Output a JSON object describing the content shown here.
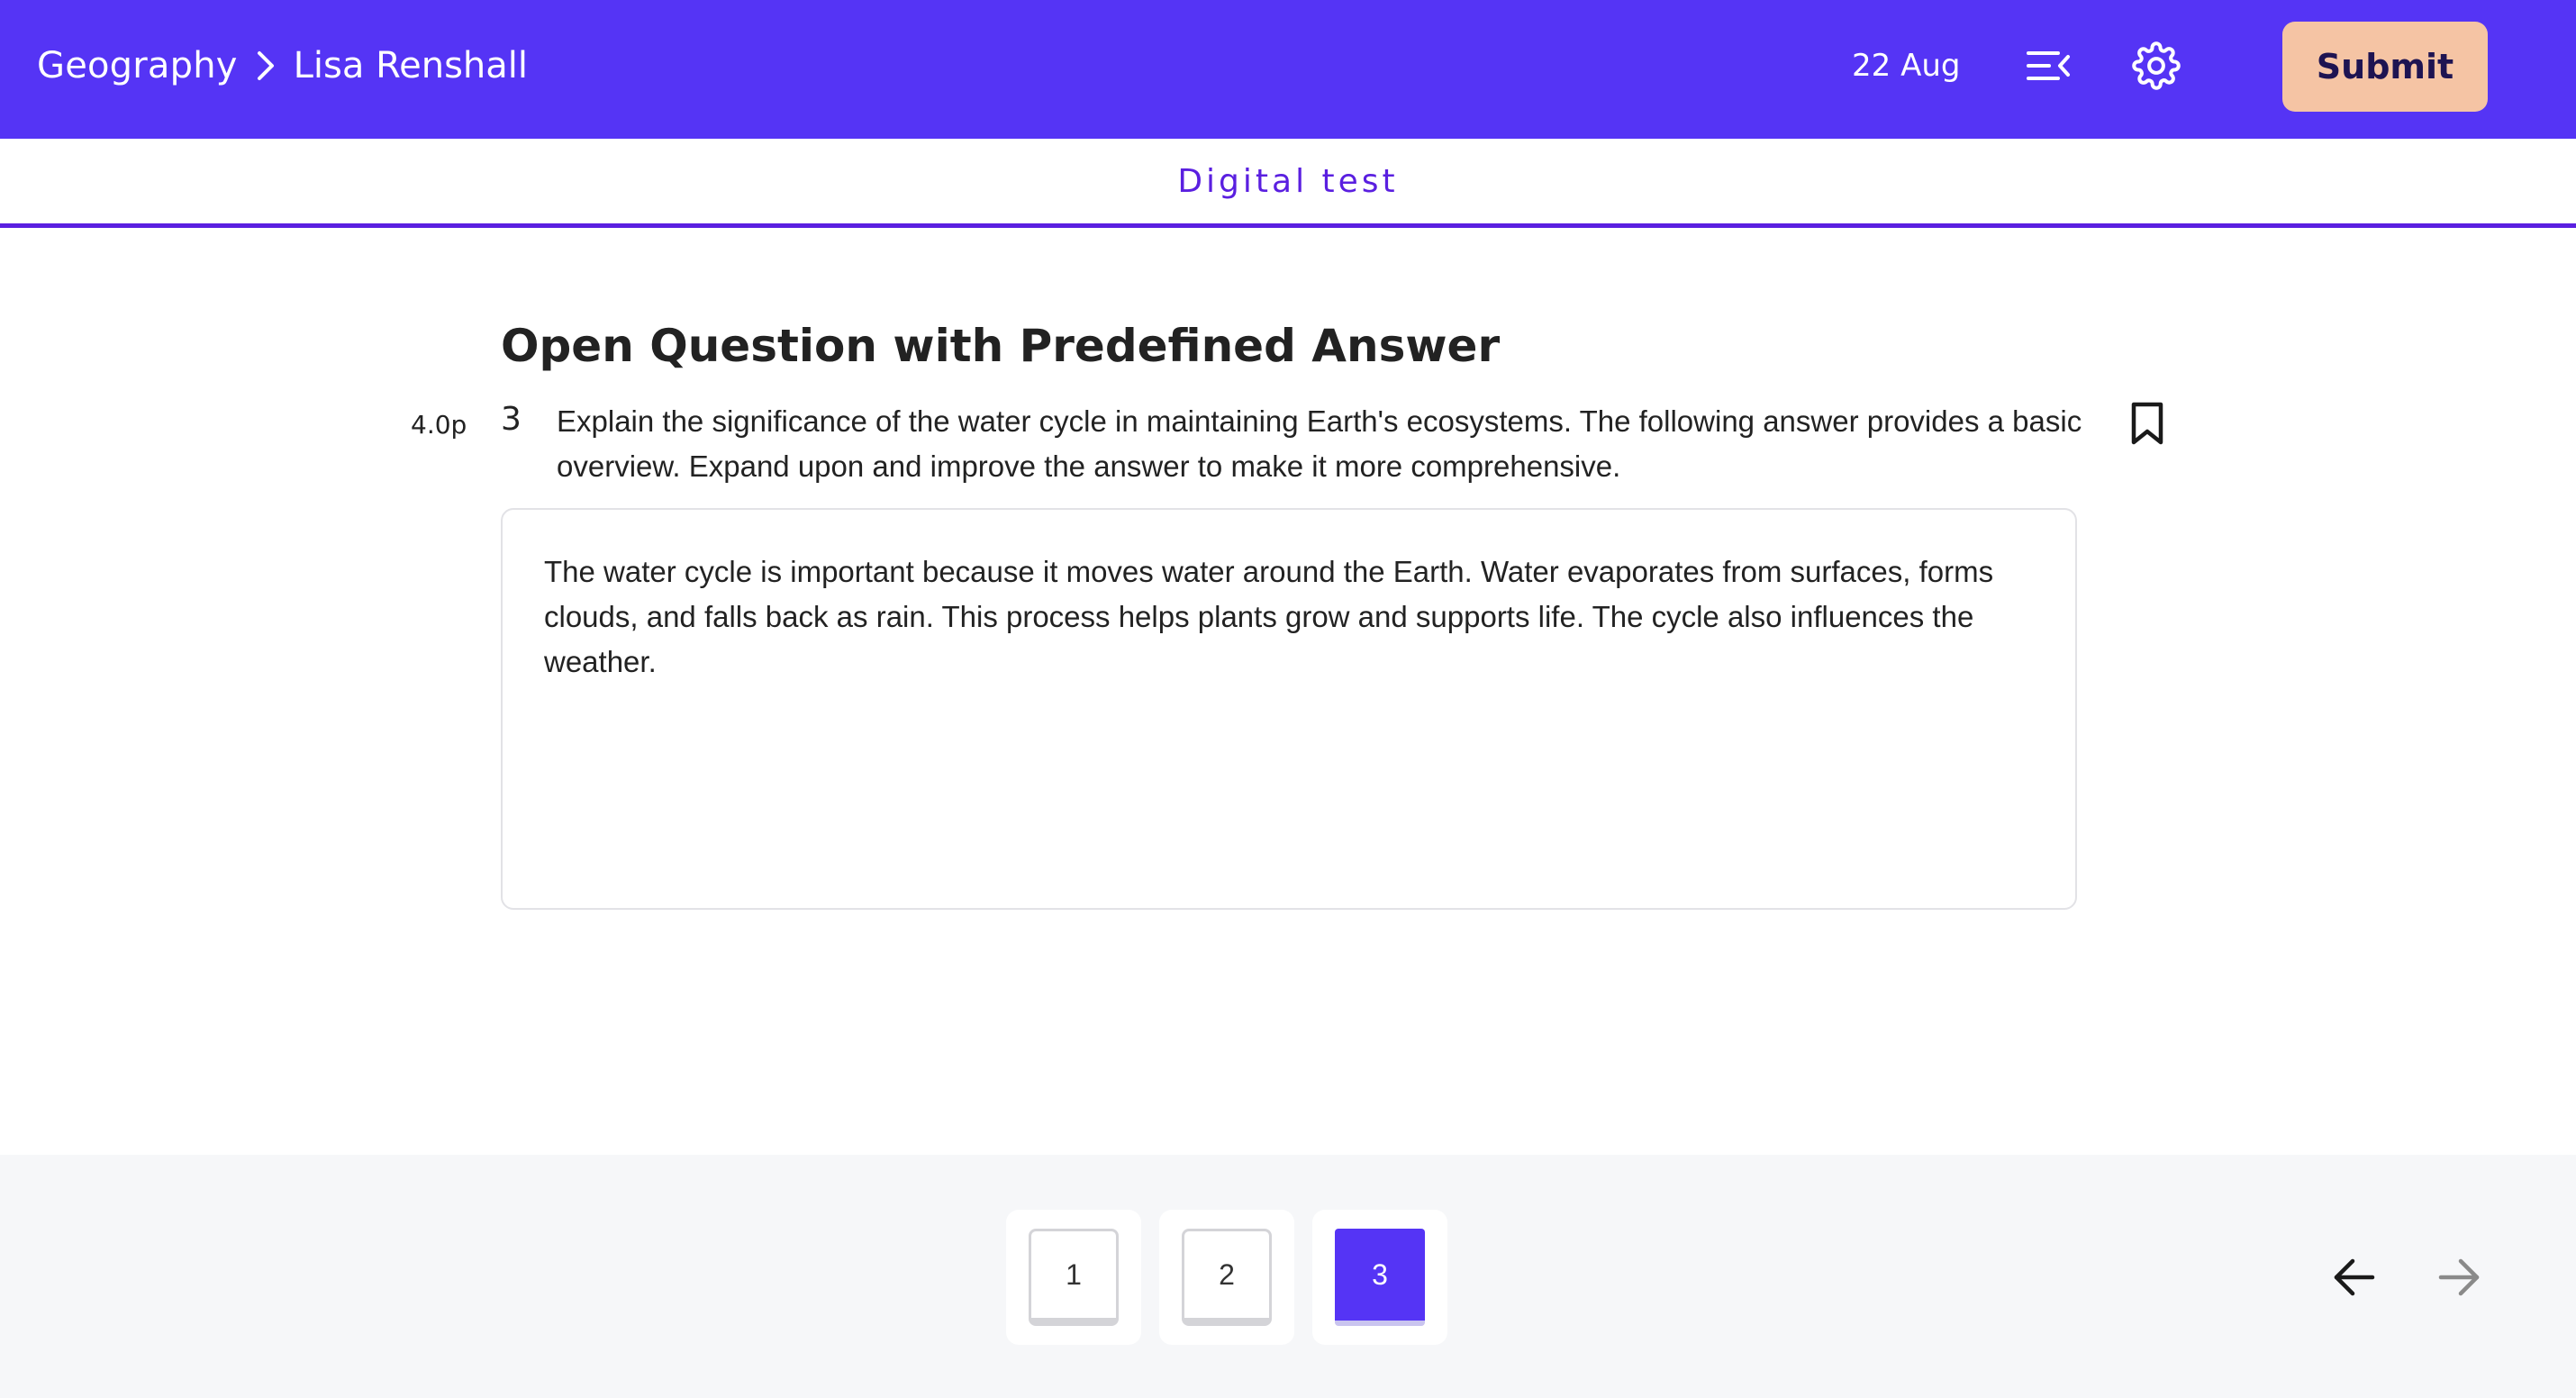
{
  "header": {
    "breadcrumb": {
      "subject": "Geography",
      "separator_icon": "chevron-right-icon",
      "student": "Lisa Renshall"
    },
    "date": "22 Aug",
    "menu_icon": "collapse-menu-icon",
    "settings_icon": "gear-icon",
    "submit_label": "Submit"
  },
  "subheader": {
    "title": "Digital test"
  },
  "question": {
    "section_title": "Open Question with Predefined Answer",
    "points": "4.0p",
    "number": "3",
    "text": "Explain the significance of the water cycle in maintaining Earth's ecosystems. The following answer provides a basic overview. Expand upon and improve the answer to make it more comprehensive.",
    "bookmark_icon": "bookmark-icon",
    "answer": "The water cycle is important because it moves water around the Earth. Water evaporates from surfaces, forms clouds, and falls back as rain. This process helps plants grow and supports life. The cycle also influences the weather."
  },
  "pagination": {
    "pages": [
      "1",
      "2",
      "3"
    ],
    "current": "3",
    "prev_icon": "arrow-left-icon",
    "next_icon": "arrow-right-icon"
  },
  "colors": {
    "header_bg": "#5534f5",
    "submit_bg": "#f5c4a4",
    "accent": "#5a1fe0",
    "bottom_bg": "#f6f7f9",
    "active_page": "#5534f5"
  }
}
